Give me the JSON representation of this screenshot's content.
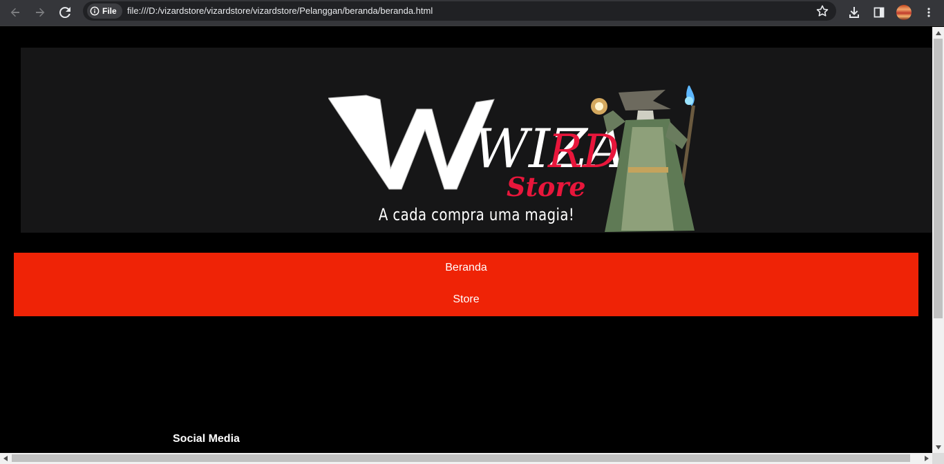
{
  "browser": {
    "site_chip_label": "File",
    "url": "file:///D:/vizardstore/vizardstore/vizardstore/Pelanggan/beranda/beranda.html",
    "icons": [
      "back-icon",
      "forward-icon",
      "reload-icon",
      "info-icon",
      "star-icon",
      "download-icon",
      "side-panel-icon",
      "profile-avatar",
      "kebab-menu-icon"
    ]
  },
  "banner": {
    "logo_main": "WIZA",
    "logo_accent": "RD",
    "logo_sub": "Store",
    "tagline": "A cada compra uma magia!",
    "colors": {
      "background": "#161617",
      "logo_white": "#ffffff",
      "logo_red": "#e8163b"
    }
  },
  "nav": {
    "items": [
      {
        "label": "Beranda"
      },
      {
        "label": "Store"
      }
    ],
    "color": "#ef2306"
  },
  "footer": {
    "social_title": "Social Media"
  }
}
